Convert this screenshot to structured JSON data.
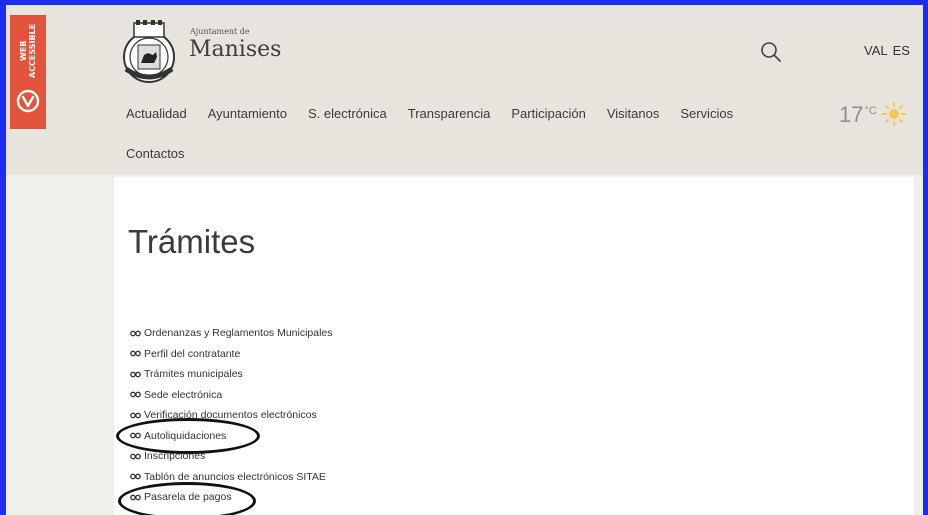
{
  "accessibility": {
    "label": "WEB ACCESSIBLE"
  },
  "header": {
    "logo": {
      "small_text": "Ajuntament de",
      "big_text": "Manises"
    },
    "search_icon": "search-icon",
    "languages": [
      "VAL",
      "ES"
    ],
    "nav": {
      "row1": [
        "Actualidad",
        "Ayuntamiento",
        "S. electrónica",
        "Transparencia",
        "Participación",
        "Visitanos",
        "Servicios"
      ],
      "row2": [
        "Contactos"
      ]
    },
    "weather": {
      "temperature": "17",
      "unit": "°C",
      "icon": "sun-icon"
    }
  },
  "main": {
    "title": "Trámites",
    "links": [
      "Ordenanzas y Reglamentos Municipales",
      "Perfil del contratante",
      "Trámites municipales",
      "Sede electrónica",
      "Verificación documentos electrónicos",
      "Autoliquidaciones",
      "Inscripciones",
      "Tablón de anuncios electrónicos SITAE",
      "Pasarela de pagos"
    ]
  },
  "colors": {
    "frame": "#1b2cf3",
    "accessibility_tab": "#e4533b",
    "header_bg": "#e6e4dc",
    "sun": "#f2c94c"
  }
}
